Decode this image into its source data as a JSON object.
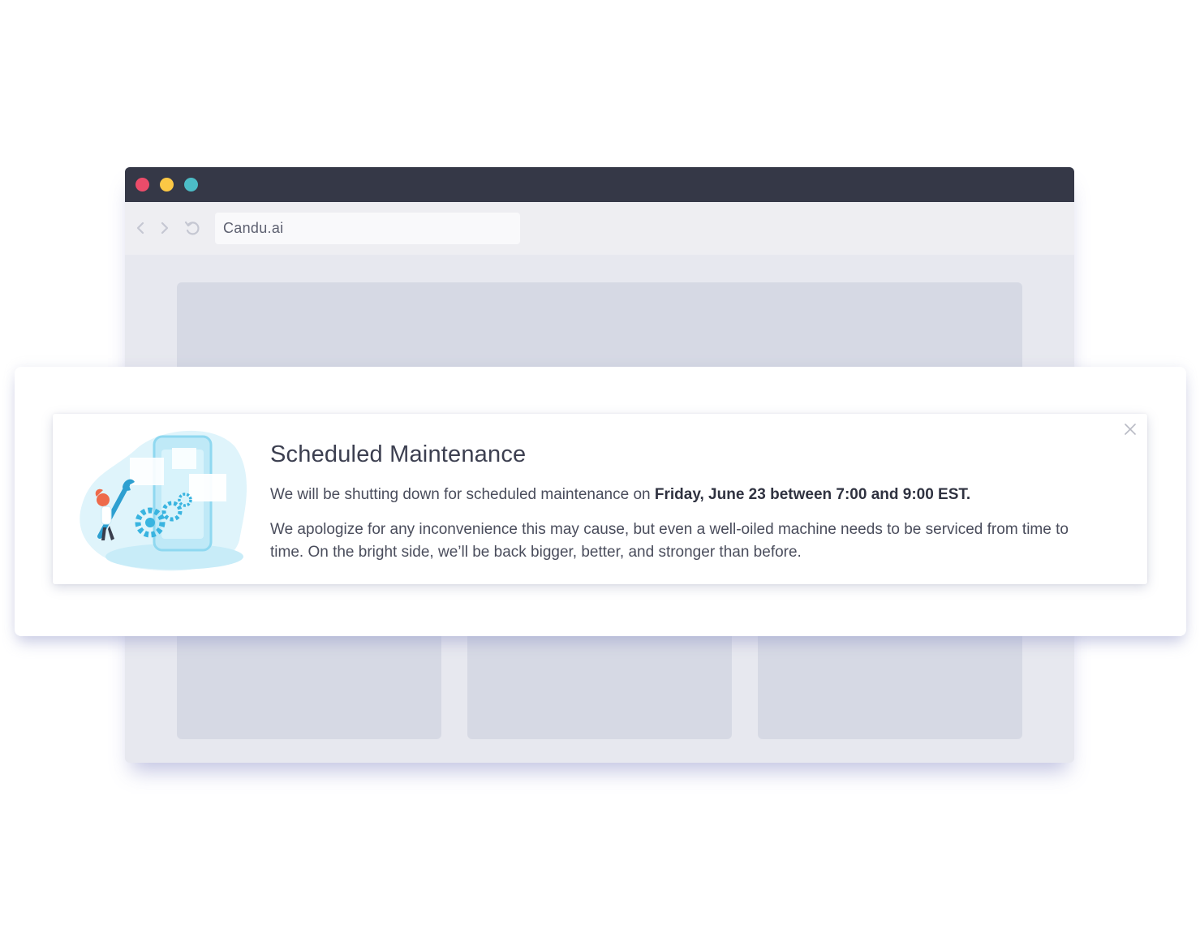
{
  "browser": {
    "url": "Candu.ai",
    "window_controls": [
      "close",
      "minimize",
      "maximize"
    ],
    "nav_icons": [
      "chevron-left-icon",
      "chevron-right-icon",
      "reload-icon"
    ],
    "colors": {
      "titlebar": "#353847",
      "close": "#ec4c6a",
      "minimize": "#fcc845",
      "maximize": "#4cbcc6"
    }
  },
  "banner": {
    "title": "Scheduled Maintenance",
    "line1_prefix": "We will be shutting down for scheduled maintenance on ",
    "line1_emphasis": "Friday, June 23 between 7:00 and 9:00 EST.",
    "paragraph": "We apologize for any inconvenience this may cause, but even a well-oiled machine needs to be serviced from time to time. On the bright side, we’ll be back bigger, better, and stronger than before.",
    "close_icon": "close-icon",
    "illustration": "maintenance-illustration"
  }
}
